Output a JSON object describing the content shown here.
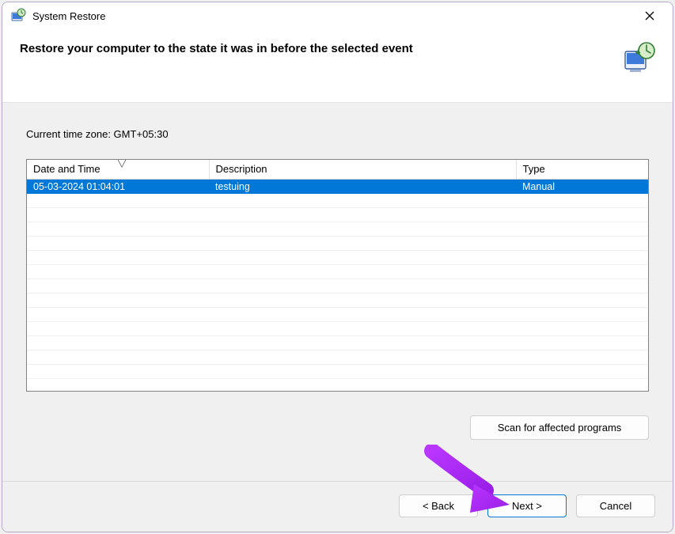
{
  "window": {
    "title": "System Restore"
  },
  "header": {
    "instruction": "Restore your computer to the state it was in before the selected event"
  },
  "content": {
    "timezone_label": "Current time zone: GMT+05:30",
    "columns": {
      "date": "Date and Time",
      "desc": "Description",
      "type": "Type"
    },
    "rows": [
      {
        "date": "05-03-2024 01:04:01",
        "desc": "testuing",
        "type": "Manual",
        "selected": true
      }
    ],
    "scan_button": "Scan for affected programs"
  },
  "footer": {
    "back": "< Back",
    "next": "Next >",
    "cancel": "Cancel"
  }
}
